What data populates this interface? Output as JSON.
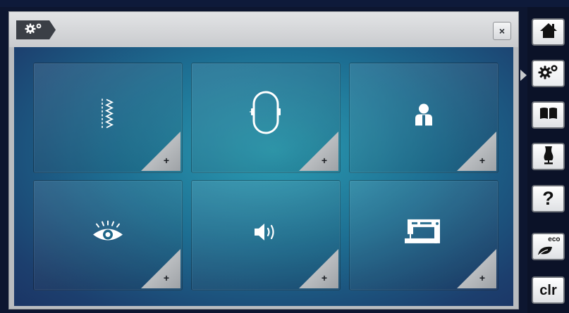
{
  "window": {
    "title_icon": "settings-gears-icon",
    "close_label": "×"
  },
  "tiles": [
    {
      "name": "stitch-settings",
      "icon": "zigzag-stitch-icon",
      "corner_label": "+"
    },
    {
      "name": "embroidery-settings",
      "icon": "embroidery-hoop-icon",
      "corner_label": "+"
    },
    {
      "name": "personal-settings",
      "icon": "user-icon",
      "corner_label": "+"
    },
    {
      "name": "monitoring-settings",
      "icon": "eye-icon",
      "corner_label": "+"
    },
    {
      "name": "audio-settings",
      "icon": "speaker-icon",
      "corner_label": "+"
    },
    {
      "name": "machine-settings",
      "icon": "sewing-machine-icon",
      "corner_label": "+"
    }
  ],
  "sidebar": {
    "items": [
      {
        "name": "home",
        "icon": "home-icon"
      },
      {
        "name": "setup",
        "icon": "settings-gears-icon",
        "active": true
      },
      {
        "name": "tutorial",
        "icon": "open-book-icon"
      },
      {
        "name": "creative-consultant",
        "icon": "dress-form-icon"
      },
      {
        "name": "help",
        "icon": "question-icon",
        "label": "?"
      },
      {
        "name": "eco",
        "icon": "eco-leaf-icon",
        "label": "eco"
      },
      {
        "name": "clear",
        "icon": "clear-icon",
        "label": "clr"
      }
    ]
  },
  "colors": {
    "content_center": "#2b9db3",
    "content_edge": "#1b3565",
    "window_chrome": "#c9cbce",
    "sidebar_bg": "#0b1228"
  }
}
